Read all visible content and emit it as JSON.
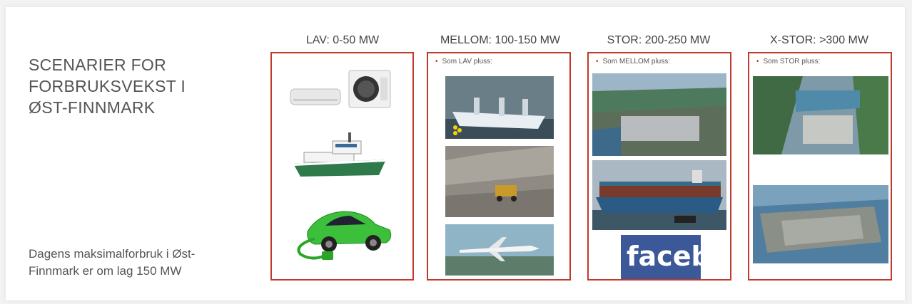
{
  "title": {
    "lines": [
      "SCENARIER FOR",
      "FORBRUKSVEKST I",
      "ØST-FINNMARK"
    ]
  },
  "note": {
    "lines": [
      "Dagens maksimalforbruk i Øst-",
      "Finnmark er om lag 150 MW"
    ]
  },
  "columns": [
    {
      "heading": "LAV: 0-50 MW",
      "bullet": ""
    },
    {
      "heading": "MELLOM: 100-150 MW",
      "bullet": "Som LAV pluss:"
    },
    {
      "heading": "STOR: 200-250 MW",
      "bullet": "Som MELLOM pluss:"
    },
    {
      "heading": "X-STOR: >300 MW",
      "bullet": "Som STOR pluss:"
    }
  ],
  "images": {
    "facebook_sign_text": "faceb"
  },
  "colors": {
    "border": "#c0392b",
    "text": "#555555"
  }
}
